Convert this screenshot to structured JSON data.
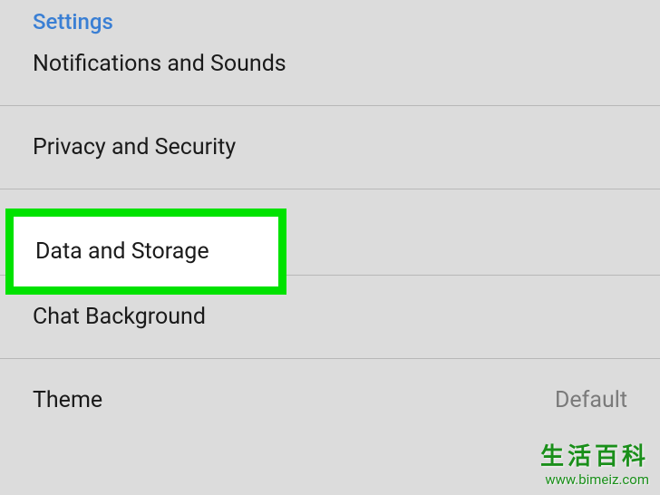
{
  "section_header": "Settings",
  "items": [
    {
      "label": "Notifications and Sounds"
    },
    {
      "label": "Privacy and Security"
    },
    {
      "label": "Data and Storage",
      "highlighted": true
    },
    {
      "label": "Chat Background"
    },
    {
      "label": "Theme",
      "value": "Default"
    }
  ],
  "watermark": {
    "main": "生活百科",
    "url": "www.bimeiz.com"
  }
}
